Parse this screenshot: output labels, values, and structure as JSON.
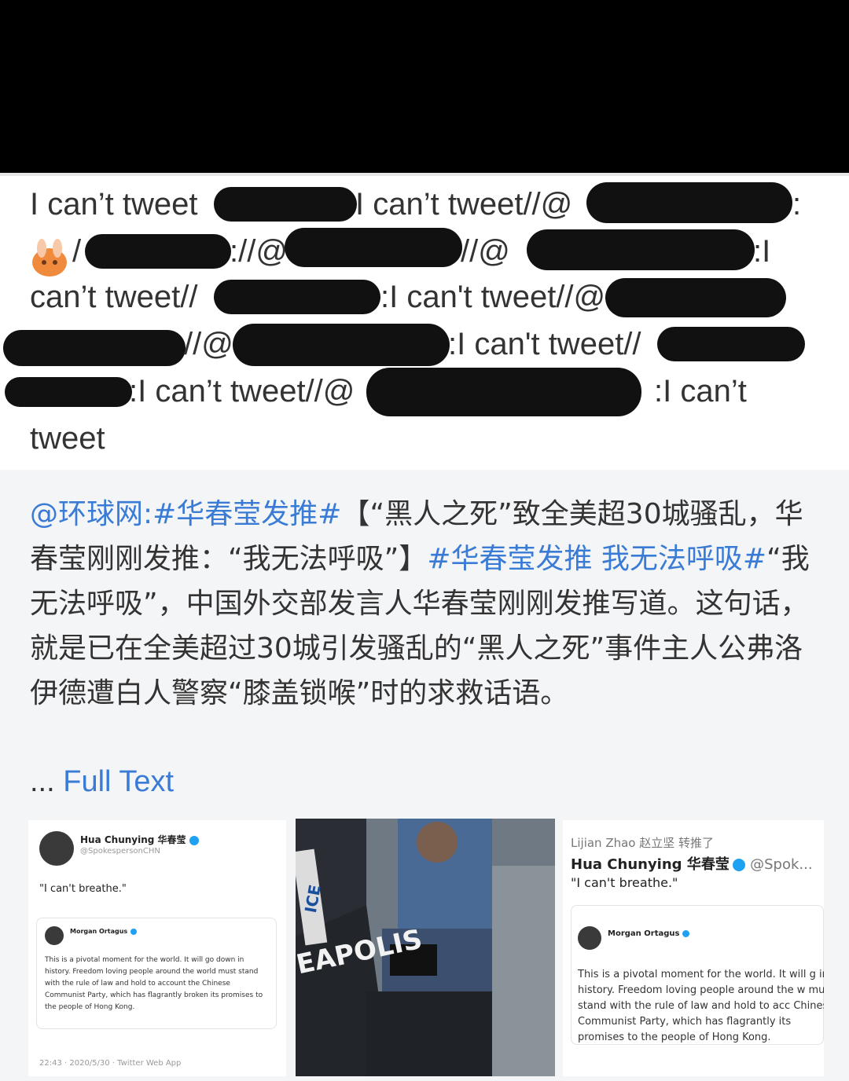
{
  "repost": {
    "segments": [
      "I can’t tweet",
      "I can’t tweet//@",
      ":",
      "/",
      "://@",
      "//@",
      ":I",
      "can’t tweet//",
      ":I can't tweet//@",
      "//@",
      ":I can't tweet//",
      ":I can’t tweet//@",
      ":I can’t",
      "tweet"
    ]
  },
  "original": {
    "mention": "@环球网",
    "hashtag1": ":#华春莹发推#",
    "body1": "【“黑人之死”致全美超30城骚乱，华春莹刚刚发推：“我无法呼吸”】",
    "hashtag2": "#华春莹发推 我无法呼吸#",
    "body2": "“我无法呼吸”，中国外交部发言人华春莹刚刚发推写道。这句话，就是已在全美超过30城引发骚乱的“黑人之死”事件主人公弗洛伊德遭白人警察“膝盖锁喉”时的求救话语。",
    "full_text_dots": "...",
    "full_text_label": "Full Text"
  },
  "card1": {
    "name": "Hua Chunying 华春莹",
    "handle": "@SpokespersonCHN",
    "tweet": "\"I can't breathe.\"",
    "quoted_name": "Morgan Ortagus",
    "quoted_text": "This is a pivotal moment for the world. It will go down in history. Freedom loving people around the world must stand with the rule of law and hold to account the Chinese Communist Party, which has flagrantly broken its promises to the people of Hong Kong.",
    "footer": "22:43 · 2020/5/30 · Twitter Web App"
  },
  "card2": {
    "car_text": "EAPOLIS",
    "police_text": "ICE"
  },
  "card3": {
    "retweet_line": "Lijian Zhao 赵立坚 转推了",
    "name": "Hua Chunying 华春莹",
    "handle": "@Spok...",
    "tweet": "\"I can't breathe.\"",
    "quoted_name": "Morgan Ortagus",
    "quoted_text": "This is a pivotal moment for the world. It will g in history. Freedom loving people around the w must stand with the rule of law and hold to acc Chinese Communist Party, which has flagrantly its promises to the people of Hong Kong."
  },
  "colors": {
    "link": "#3a7bd5",
    "redaction": "#111111",
    "verified": "#1da1f2"
  }
}
